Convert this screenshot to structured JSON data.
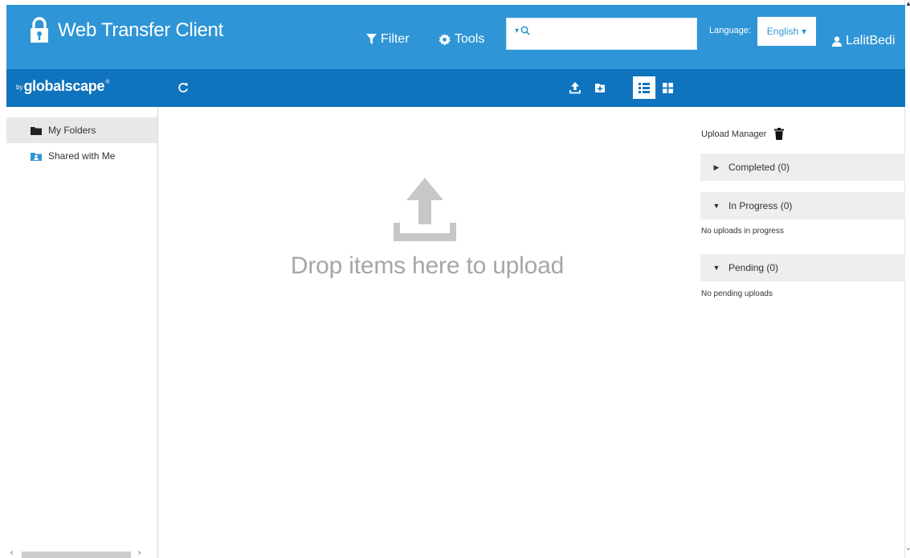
{
  "header": {
    "app_title": "Web Transfer Client",
    "filter_label": "Filter",
    "tools_label": "Tools",
    "search": {
      "value": "",
      "placeholder": ""
    },
    "language_label": "Language:",
    "language_value": "English",
    "user_name": "LalitBedi"
  },
  "subbar": {
    "brand_prefix": "by",
    "brand_name": "globalscape",
    "brand_mark": "®"
  },
  "sidebar": {
    "items": [
      {
        "label": "My Folders",
        "icon": "folder-icon",
        "active": true
      },
      {
        "label": "Shared with Me",
        "icon": "shared-folder-icon",
        "active": false
      }
    ]
  },
  "drop_zone": {
    "text": "Drop items here to upload"
  },
  "upload_manager": {
    "title": "Upload Manager",
    "sections": [
      {
        "label": "Completed (0)",
        "expanded": false,
        "empty_text": ""
      },
      {
        "label": "In Progress (0)",
        "expanded": true,
        "empty_text": "No uploads in progress"
      },
      {
        "label": "Pending (0)",
        "expanded": true,
        "empty_text": "No pending uploads"
      }
    ]
  },
  "colors": {
    "header_bg": "#2f95d6",
    "subbar_bg": "#0f74bd",
    "active_sidebar_bg": "#e8e8e8",
    "section_bg": "#eeeeee",
    "drop_text": "#a6a6a6"
  }
}
